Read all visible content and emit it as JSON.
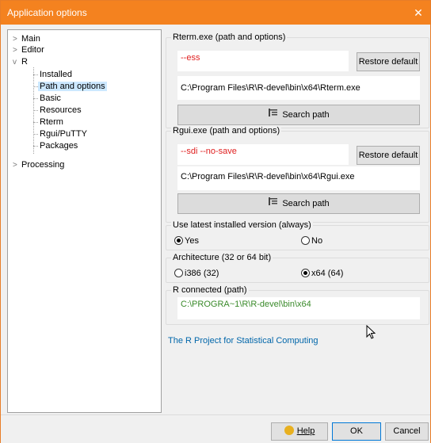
{
  "window": {
    "title": "Application options",
    "close_glyph": "✕"
  },
  "tree": {
    "items": [
      {
        "label": "Main",
        "toggle": ">"
      },
      {
        "label": "Editor",
        "toggle": ">"
      },
      {
        "label": "R",
        "toggle": "v"
      },
      {
        "label": "Installed"
      },
      {
        "label": "Path and options"
      },
      {
        "label": "Basic"
      },
      {
        "label": "Resources"
      },
      {
        "label": "Rterm"
      },
      {
        "label": "Rgui/PuTTY"
      },
      {
        "label": "Packages"
      },
      {
        "label": "Processing",
        "toggle": ">"
      }
    ],
    "selected": "Path and options"
  },
  "rterm": {
    "group_label": "Rterm.exe (path and options)",
    "options_value": "--ess",
    "restore_label": "Restore default",
    "path_value": "C:\\Program Files\\R\\R-devel\\bin\\x64\\Rterm.exe",
    "search_label": "Search path"
  },
  "rgui": {
    "group_label": "Rgui.exe (path and options)",
    "options_value": "--sdi --no-save",
    "restore_label": "Restore default",
    "path_value": "C:\\Program Files\\R\\R-devel\\bin\\x64\\Rgui.exe",
    "search_label": "Search path"
  },
  "latest": {
    "group_label": "Use latest installed version (always)",
    "yes_label": "Yes",
    "no_label": "No",
    "selected": "Yes"
  },
  "arch": {
    "group_label": "Architecture (32 or 64 bit)",
    "opt1_label": "i386 (32)",
    "opt2_label": "x64 (64)",
    "selected": "x64 (64)"
  },
  "connected": {
    "group_label": "R connected (path)",
    "path_value": "C:\\PROGRA~1\\R\\R-devel\\bin\\x64"
  },
  "link_text": "The R Project for Statistical Computing",
  "buttons": {
    "help": "Help",
    "ok": "OK",
    "cancel": "Cancel"
  },
  "icons": {
    "search": "tree-search-icon",
    "help": "help-bulb-icon"
  },
  "colors": {
    "titlebar": "#f4821f",
    "options_text": "#e02020",
    "connected_text": "#3a8a2a",
    "link": "#0066aa",
    "selection": "#cce8ff"
  }
}
